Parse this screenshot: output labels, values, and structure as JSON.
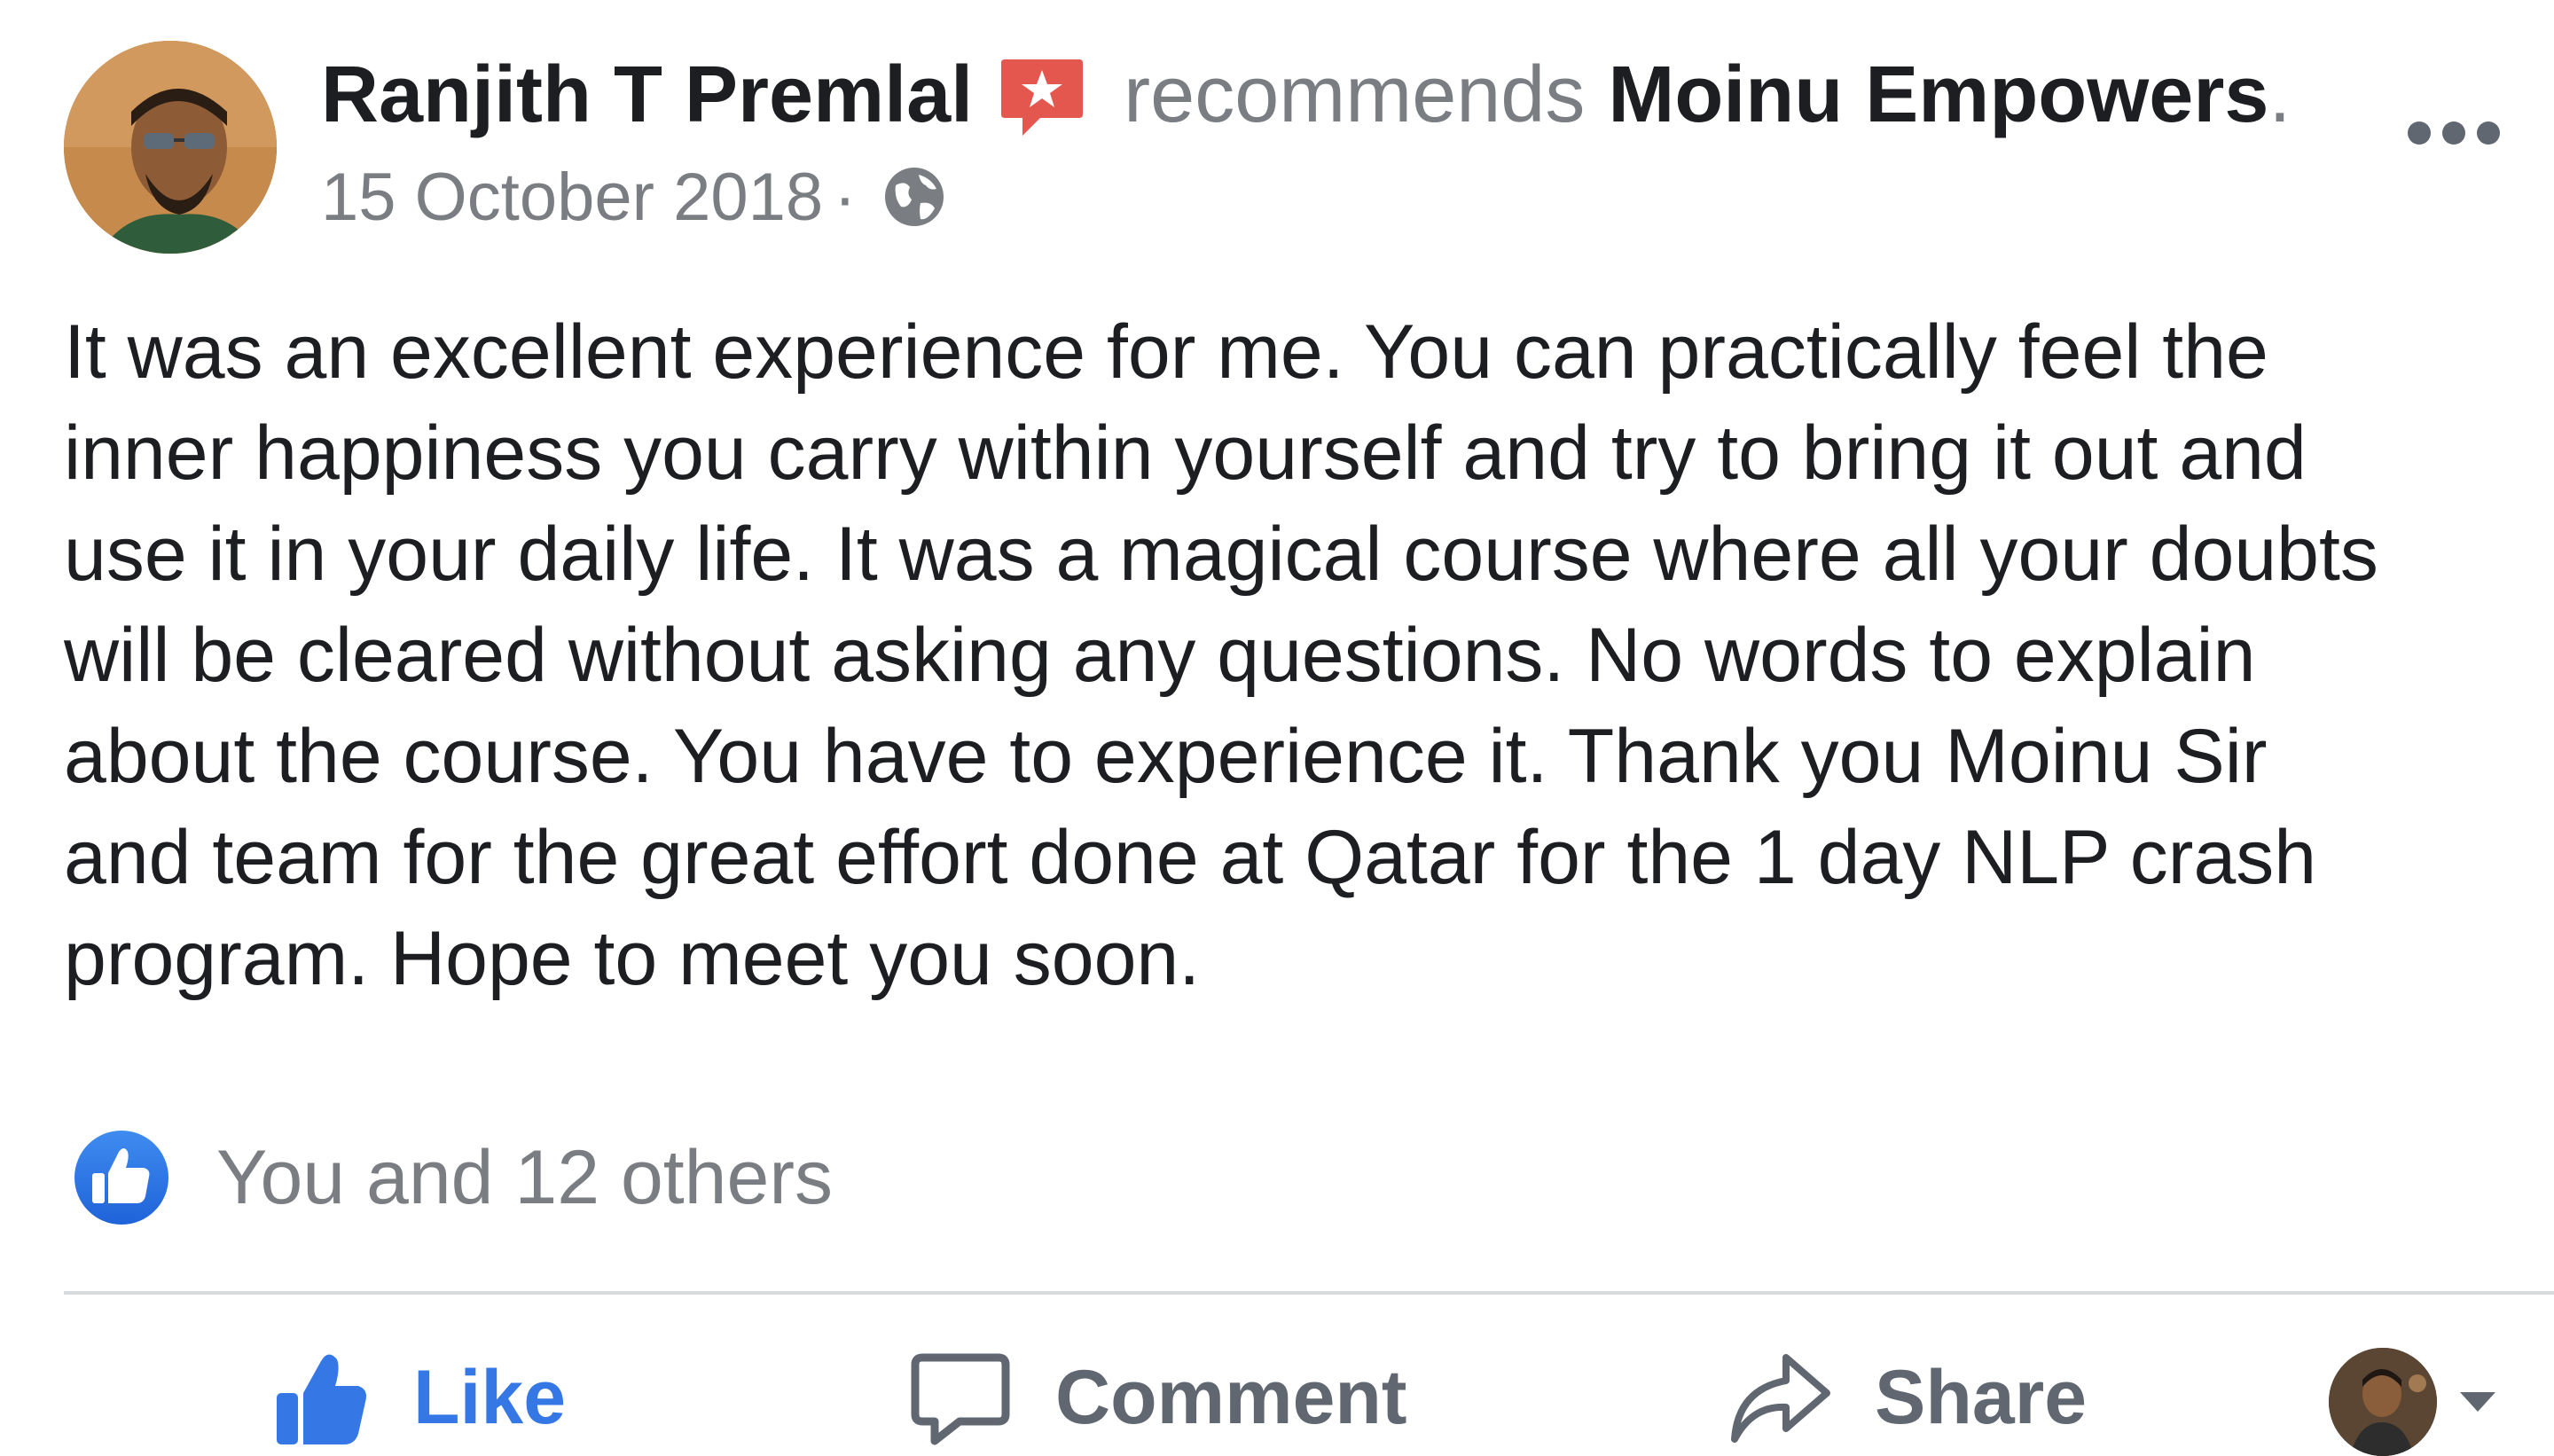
{
  "post": {
    "author": {
      "name": "Ranjith T Premlal",
      "avatar_icon": "profile-photo"
    },
    "action_verb": "recommends",
    "page_name": "Moinu Empowers",
    "page_name_suffix": ".",
    "recommend_icon": "recommendation-star-badge-icon",
    "date": "15 October 2018",
    "meta_separator": "·",
    "privacy_icon": "globe-icon",
    "more_icon": "more-options-icon",
    "body_lines": [
      "It was an excellent experience for me. You can practically feel the",
      "inner happiness you carry within yourself and try to bring it out and",
      "use it in your daily life. It was a magical course where all your doubts",
      "will be cleared without asking any questions. No words to explain",
      "about the course. You have to experience it. Thank you Moinu Sir",
      "and team for the great effort done at Qatar for the 1 day NLP crash",
      "program. Hope to meet you soon."
    ]
  },
  "reactions": {
    "icon": "like-reaction-icon",
    "summary": "You and 12 others"
  },
  "actions": {
    "like_label": "Like",
    "comment_label": "Comment",
    "share_label": "Share",
    "like_icon": "thumbs-up-icon",
    "comment_icon": "comment-bubble-icon",
    "share_icon": "share-arrow-icon",
    "profile_switch_icon": "caret-down-icon"
  },
  "colors": {
    "accent_blue": "#3578e5",
    "recommend_red": "#e4574f",
    "muted_text": "#7a7d82",
    "primary_text": "#1c1e21",
    "divider": "#d9dadc"
  }
}
